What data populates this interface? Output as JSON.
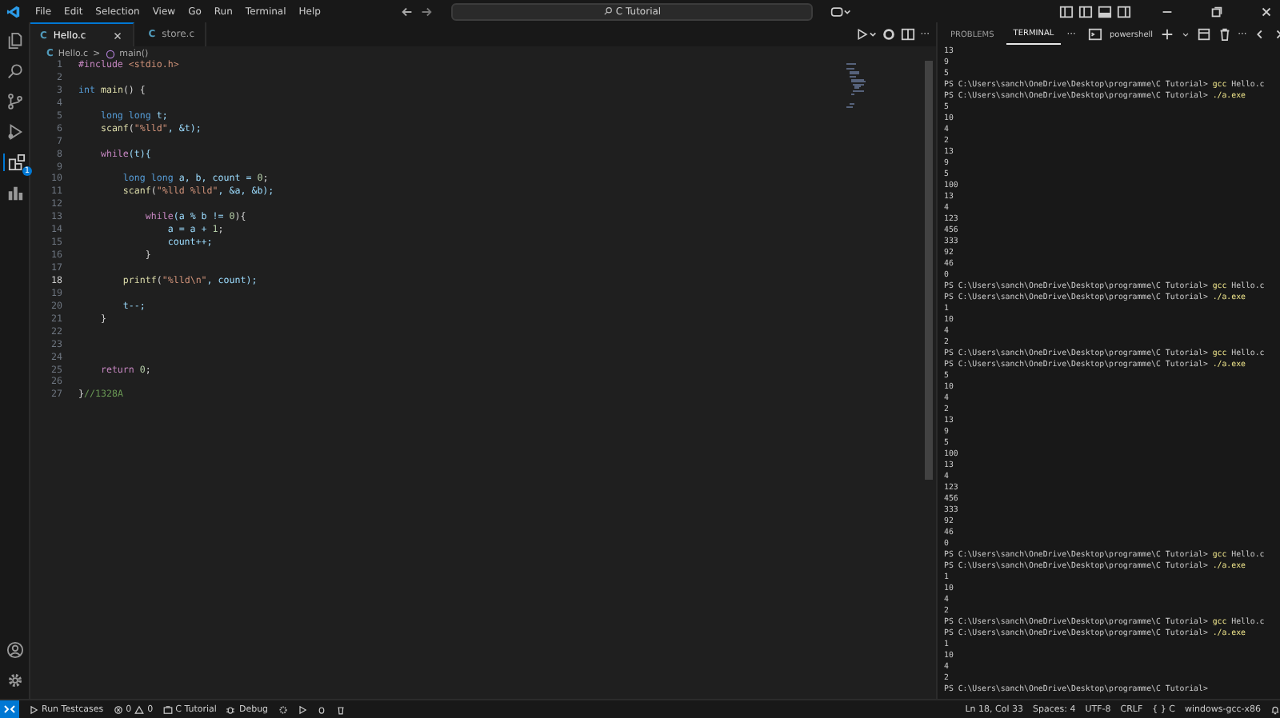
{
  "menu": [
    "File",
    "Edit",
    "Selection",
    "View",
    "Go",
    "Run",
    "Terminal",
    "Help"
  ],
  "command_center": {
    "label": "C Tutorial"
  },
  "activity_badge": "1",
  "tabs": [
    {
      "icon": "C",
      "label": "Hello.c",
      "selected": true
    },
    {
      "icon": "C",
      "label": "store.c",
      "selected": false
    }
  ],
  "editor_more": "···",
  "breadcrumb": {
    "file_icon": "C",
    "file": "Hello.c",
    "separator": ">",
    "symbol": "main()"
  },
  "editor": {
    "lines": [
      {
        "n": "1",
        "current": false,
        "tokens": [
          {
            "t": "#include",
            "kind": "kw"
          },
          {
            "t": " <stdio.h>",
            "kind": "str"
          }
        ]
      },
      {
        "n": "2",
        "current": false
      },
      {
        "n": "3",
        "current": false,
        "tokens": [
          {
            "t": "int",
            "kind": "type"
          },
          {
            "t": " main",
            "kind": "func"
          },
          {
            "t": "() {",
            "kind": "plain"
          }
        ]
      },
      {
        "n": "4",
        "current": false
      },
      {
        "n": "5",
        "current": false,
        "tokens": [
          {
            "t": "    long long",
            "kind": "type"
          },
          {
            "t": " t;",
            "kind": "var"
          }
        ]
      },
      {
        "n": "6",
        "current": false,
        "tokens": [
          {
            "t": "    scanf",
            "kind": "func"
          },
          {
            "t": "(",
            "kind": "plain"
          },
          {
            "t": "\"%lld\"",
            "kind": "str"
          },
          {
            "t": ", &t);",
            "kind": "var"
          }
        ]
      },
      {
        "n": "7",
        "current": false
      },
      {
        "n": "8",
        "current": false,
        "tokens": [
          {
            "t": "    while",
            "kind": "kw"
          },
          {
            "t": "(t){",
            "kind": "var"
          }
        ]
      },
      {
        "n": "9",
        "current": false
      },
      {
        "n": "10",
        "current": false,
        "tokens": [
          {
            "t": "        long long",
            "kind": "type"
          },
          {
            "t": " a, b, count = ",
            "kind": "var"
          },
          {
            "t": "0",
            "kind": "num"
          },
          {
            "t": ";",
            "kind": "plain"
          }
        ]
      },
      {
        "n": "11",
        "current": false,
        "tokens": [
          {
            "t": "        scanf",
            "kind": "func"
          },
          {
            "t": "(",
            "kind": "plain"
          },
          {
            "t": "\"%lld %lld\"",
            "kind": "str"
          },
          {
            "t": ", &a, &b);",
            "kind": "var"
          }
        ]
      },
      {
        "n": "12",
        "current": false
      },
      {
        "n": "13",
        "current": false,
        "tokens": [
          {
            "t": "            while",
            "kind": "kw"
          },
          {
            "t": "(a % b != ",
            "kind": "var"
          },
          {
            "t": "0",
            "kind": "num"
          },
          {
            "t": "){",
            "kind": "plain"
          }
        ]
      },
      {
        "n": "14",
        "current": false,
        "tokens": [
          {
            "t": "                a = a + ",
            "kind": "var"
          },
          {
            "t": "1",
            "kind": "num"
          },
          {
            "t": ";",
            "kind": "plain"
          }
        ]
      },
      {
        "n": "15",
        "current": false,
        "tokens": [
          {
            "t": "                count++;",
            "kind": "var"
          }
        ]
      },
      {
        "n": "16",
        "current": false,
        "tokens": [
          {
            "t": "            }",
            "kind": "plain"
          }
        ]
      },
      {
        "n": "17",
        "current": false
      },
      {
        "n": "18",
        "current": true,
        "tokens": [
          {
            "t": "        printf",
            "kind": "func"
          },
          {
            "t": "(",
            "kind": "plain"
          },
          {
            "t": "\"%lld\\n\"",
            "kind": "str"
          },
          {
            "t": ", count);",
            "kind": "var"
          }
        ]
      },
      {
        "n": "19",
        "current": false
      },
      {
        "n": "20",
        "current": false,
        "tokens": [
          {
            "t": "        t--;",
            "kind": "var"
          }
        ]
      },
      {
        "n": "21",
        "current": false,
        "tokens": [
          {
            "t": "    }",
            "kind": "plain"
          }
        ]
      },
      {
        "n": "22",
        "current": false
      },
      {
        "n": "23",
        "current": false
      },
      {
        "n": "24",
        "current": false
      },
      {
        "n": "25",
        "current": false,
        "tokens": [
          {
            "t": "    return",
            "kind": "kw"
          },
          {
            "t": " 0",
            "kind": "num"
          },
          {
            "t": ";",
            "kind": "plain"
          }
        ]
      },
      {
        "n": "26",
        "current": false
      },
      {
        "n": "27",
        "current": false,
        "tokens": [
          {
            "t": "}",
            "kind": "plain"
          },
          {
            "t": "//1328A",
            "kind": "comment"
          }
        ]
      }
    ]
  },
  "panel_tabs": [
    {
      "label": "PROBLEMS",
      "selected": false
    },
    {
      "label": "TERMINAL",
      "selected": true
    }
  ],
  "panel_more": "···",
  "terminal_name": "powershell",
  "terminal_more": "···",
  "terminal": [
    {
      "kind": "output",
      "text": "13"
    },
    {
      "kind": "output",
      "text": "9"
    },
    {
      "kind": "output",
      "text": "5"
    },
    {
      "kind": "prompt",
      "text": "PS C:\\Users\\sanch\\OneDrive\\Desktop\\programme\\C Tutorial>",
      "program": "gcc",
      "args": "Hello.c"
    },
    {
      "kind": "prompt",
      "text": "PS C:\\Users\\sanch\\OneDrive\\Desktop\\programme\\C Tutorial>",
      "program": "./a.exe"
    },
    {
      "kind": "output",
      "text": "5"
    },
    {
      "kind": "output",
      "text": "10"
    },
    {
      "kind": "output",
      "text": "4"
    },
    {
      "kind": "output",
      "text": "2"
    },
    {
      "kind": "output",
      "text": "13"
    },
    {
      "kind": "output",
      "text": "9"
    },
    {
      "kind": "output",
      "text": "5"
    },
    {
      "kind": "output",
      "text": "100"
    },
    {
      "kind": "output",
      "text": "13"
    },
    {
      "kind": "output",
      "text": "4"
    },
    {
      "kind": "output",
      "text": "123"
    },
    {
      "kind": "output",
      "text": "456"
    },
    {
      "kind": "output",
      "text": "333"
    },
    {
      "kind": "output",
      "text": "92"
    },
    {
      "kind": "output",
      "text": "46"
    },
    {
      "kind": "output",
      "text": "0"
    },
    {
      "kind": "prompt",
      "text": "PS C:\\Users\\sanch\\OneDrive\\Desktop\\programme\\C Tutorial>",
      "program": "gcc",
      "args": "Hello.c"
    },
    {
      "kind": "prompt",
      "text": "PS C:\\Users\\sanch\\OneDrive\\Desktop\\programme\\C Tutorial>",
      "program": "./a.exe"
    },
    {
      "kind": "output",
      "text": "1"
    },
    {
      "kind": "output",
      "text": "10"
    },
    {
      "kind": "output",
      "text": "4"
    },
    {
      "kind": "output",
      "text": "2"
    },
    {
      "kind": "prompt",
      "text": "PS C:\\Users\\sanch\\OneDrive\\Desktop\\programme\\C Tutorial>",
      "program": "gcc",
      "args": "Hello.c"
    },
    {
      "kind": "prompt",
      "text": "PS C:\\Users\\sanch\\OneDrive\\Desktop\\programme\\C Tutorial>",
      "program": "./a.exe"
    },
    {
      "kind": "output",
      "text": "5"
    },
    {
      "kind": "output",
      "text": "10"
    },
    {
      "kind": "output",
      "text": "4"
    },
    {
      "kind": "output",
      "text": "2"
    },
    {
      "kind": "output",
      "text": "13"
    },
    {
      "kind": "output",
      "text": "9"
    },
    {
      "kind": "output",
      "text": "5"
    },
    {
      "kind": "output",
      "text": "100"
    },
    {
      "kind": "output",
      "text": "13"
    },
    {
      "kind": "output",
      "text": "4"
    },
    {
      "kind": "output",
      "text": "123"
    },
    {
      "kind": "output",
      "text": "456"
    },
    {
      "kind": "output",
      "text": "333"
    },
    {
      "kind": "output",
      "text": "92"
    },
    {
      "kind": "output",
      "text": "46"
    },
    {
      "kind": "output",
      "text": "0"
    },
    {
      "kind": "prompt",
      "text": "PS C:\\Users\\sanch\\OneDrive\\Desktop\\programme\\C Tutorial>",
      "program": "gcc",
      "args": "Hello.c"
    },
    {
      "kind": "prompt",
      "text": "PS C:\\Users\\sanch\\OneDrive\\Desktop\\programme\\C Tutorial>",
      "program": "./a.exe"
    },
    {
      "kind": "output",
      "text": "1"
    },
    {
      "kind": "output",
      "text": "10"
    },
    {
      "kind": "output",
      "text": "4"
    },
    {
      "kind": "output",
      "text": "2"
    },
    {
      "kind": "prompt",
      "text": "PS C:\\Users\\sanch\\OneDrive\\Desktop\\programme\\C Tutorial>",
      "program": "gcc",
      "args": "Hello.c"
    },
    {
      "kind": "prompt",
      "text": "PS C:\\Users\\sanch\\OneDrive\\Desktop\\programme\\C Tutorial>",
      "program": "./a.exe"
    },
    {
      "kind": "output",
      "text": "1"
    },
    {
      "kind": "output",
      "text": "10"
    },
    {
      "kind": "output",
      "text": "4"
    },
    {
      "kind": "output",
      "text": "2"
    },
    {
      "kind": "prompt",
      "text": "PS C:\\Users\\sanch\\OneDrive\\Desktop\\programme\\C Tutorial>"
    }
  ],
  "status_left": {
    "run": "Run Testcases",
    "errors": "0",
    "warnings": "0",
    "folder": "C Tutorial",
    "debug": "Debug"
  },
  "status_right": [
    "Ln 18, Col 33",
    "Spaces: 4",
    "UTF-8",
    "CRLF",
    "{ } C",
    "windows-gcc-x86"
  ]
}
